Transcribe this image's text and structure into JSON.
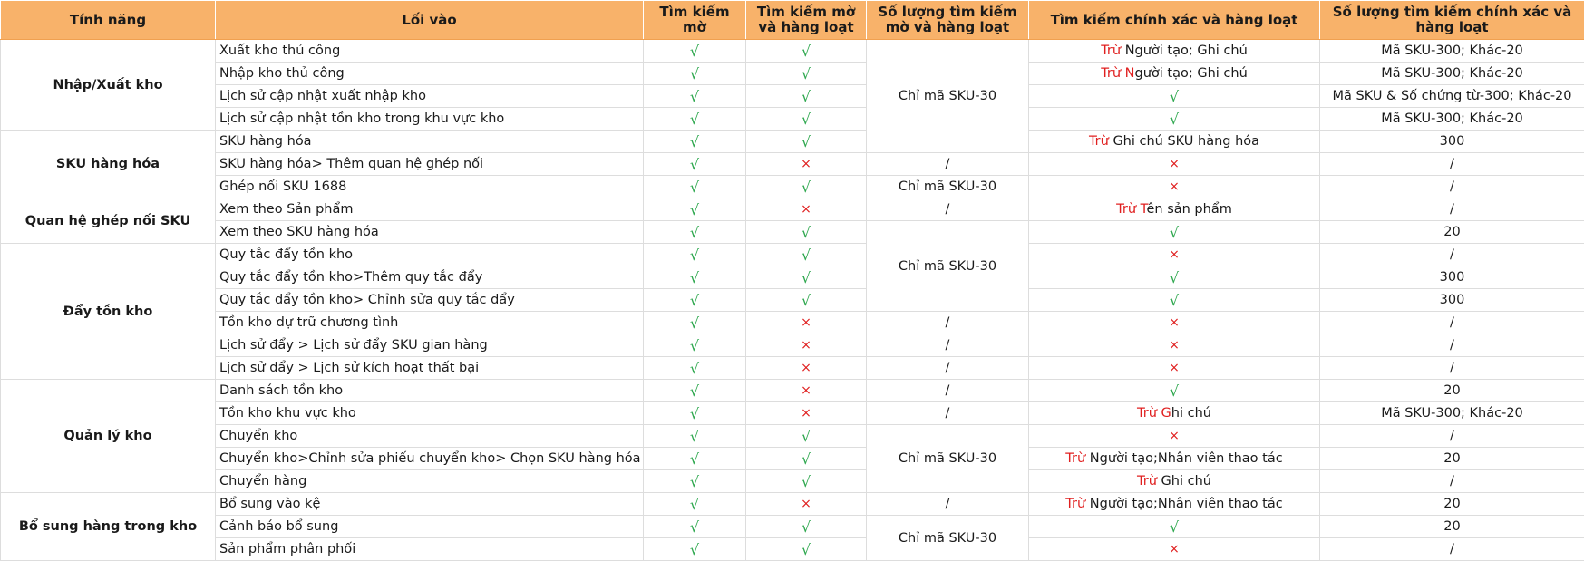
{
  "headers": {
    "feature": "Tính năng",
    "entry": "Lối vào",
    "fuzzy": "Tìm kiếm mờ",
    "fuzzy_batch": "Tìm kiếm mờ và hàng loạt",
    "fuzzy_batch_count": "Số lượng tìm kiếm mờ và hàng loạt",
    "exact_batch": "Tìm kiếm chính xác và hàng loạt",
    "exact_batch_count": "Số lượng tìm kiếm chính xác và hàng loạt"
  },
  "symbols": {
    "yes": "√",
    "no": "×"
  },
  "groups": {
    "g0": "Nhập/Xuất kho",
    "g1": "SKU hàng hóa",
    "g2": "Quan hệ ghép nối SKU",
    "g3": "Đẩy tồn kho",
    "g4": "Quản lý kho",
    "g5": "Bổ sung hàng trong kho"
  },
  "merged": {
    "m0": "Chỉ mã SKU-30",
    "m1": "Chỉ mã SKU-30",
    "m2": "Chỉ mã SKU-30",
    "m3": "Chỉ mã SKU-30",
    "m4": "Chỉ mã SKU-30"
  },
  "rows": [
    {
      "entry": "Xuất kho thủ công",
      "fuzzy": "√",
      "fuzzy_batch": "√",
      "exact_red": "Trừ ",
      "exact": "Người tạo; Ghi chú",
      "count": "Mã SKU-300; Khác-20"
    },
    {
      "entry": "Nhập kho thủ công",
      "fuzzy": "√",
      "fuzzy_batch": "√",
      "exact_red": "Trừ N",
      "exact": "gười tạo; Ghi chú",
      "count": "Mã SKU-300; Khác-20"
    },
    {
      "entry": "Lịch sử cập nhật xuất nhập kho",
      "fuzzy": "√",
      "fuzzy_batch": "√",
      "exact_red": "",
      "exact": "√",
      "count": "Mã SKU & Số chứng từ-300; Khác-20"
    },
    {
      "entry": "Lịch sử cập nhật tồn kho trong khu vực kho",
      "fuzzy": "√",
      "fuzzy_batch": "√",
      "exact_red": "",
      "exact": "√",
      "count": "Mã SKU-300; Khác-20"
    },
    {
      "entry": "SKU hàng hóa",
      "fuzzy": "√",
      "fuzzy_batch": "√",
      "exact_red": "Trừ ",
      "exact": "Ghi chú SKU hàng hóa",
      "count": "300"
    },
    {
      "entry": "SKU hàng hóa> Thêm quan hệ ghép nối",
      "fuzzy": "√",
      "fuzzy_batch": "×",
      "fuzzy_count": "/",
      "exact_red": "",
      "exact": "×",
      "count": "/"
    },
    {
      "entry": "Ghép nối SKU 1688",
      "fuzzy": "√",
      "fuzzy_batch": "√",
      "fuzzy_count": "Chỉ mã SKU-30",
      "exact_red": "",
      "exact": "×",
      "count": "/"
    },
    {
      "entry": "Xem theo Sản phẩm",
      "fuzzy": "√",
      "fuzzy_batch": "×",
      "fuzzy_count": "/",
      "exact_red": "Trừ T",
      "exact": "ên sản phẩm",
      "count": "/"
    },
    {
      "entry": "Xem theo SKU hàng hóa",
      "fuzzy": "√",
      "fuzzy_batch": "√",
      "exact_red": "",
      "exact": "√",
      "count": "20"
    },
    {
      "entry": "Quy tắc đẩy tồn kho",
      "fuzzy": "√",
      "fuzzy_batch": "√",
      "exact_red": "",
      "exact": "×",
      "count": "/"
    },
    {
      "entry": "Quy tắc đẩy tồn kho>Thêm quy tắc đẩy",
      "fuzzy": "√",
      "fuzzy_batch": "√",
      "exact_red": "",
      "exact": "√",
      "count": "300"
    },
    {
      "entry": "Quy tắc đẩy tồn kho> Chỉnh sửa quy tắc đẩy",
      "fuzzy": "√",
      "fuzzy_batch": "√",
      "exact_red": "",
      "exact": "√",
      "count": "300"
    },
    {
      "entry": "Tồn kho dự trữ chương tình",
      "fuzzy": "√",
      "fuzzy_batch": "×",
      "fuzzy_count": "/",
      "exact_red": "",
      "exact": "×",
      "count": "/"
    },
    {
      "entry": "Lịch sử đẩy > Lịch sử đẩy SKU gian hàng",
      "fuzzy": "√",
      "fuzzy_batch": "×",
      "fuzzy_count": "/",
      "exact_red": "",
      "exact": "×",
      "count": "/"
    },
    {
      "entry": "Lịch sử đẩy > Lịch sử kích hoạt thất bại",
      "fuzzy": "√",
      "fuzzy_batch": "×",
      "fuzzy_count": "/",
      "exact_red": "",
      "exact": "×",
      "count": "/"
    },
    {
      "entry": "Danh sách tồn kho",
      "fuzzy": "√",
      "fuzzy_batch": "×",
      "fuzzy_count": "/",
      "exact_red": "",
      "exact": "√",
      "count": "20"
    },
    {
      "entry": "Tồn kho khu vực kho",
      "fuzzy": "√",
      "fuzzy_batch": "×",
      "fuzzy_count": "/",
      "exact_red": "Trừ G",
      "exact": "hi chú",
      "count": "Mã SKU-300; Khác-20"
    },
    {
      "entry": "Chuyển kho",
      "fuzzy": "√",
      "fuzzy_batch": "√",
      "exact_red": "",
      "exact": "×",
      "count": "/"
    },
    {
      "entry": "Chuyển kho>Chỉnh sửa phiếu chuyển kho> Chọn SKU hàng hóa",
      "fuzzy": "√",
      "fuzzy_batch": "√",
      "exact_red": "Trừ ",
      "exact": "Người tạo;Nhân viên thao tác",
      "count": "20"
    },
    {
      "entry": "Chuyển hàng",
      "fuzzy": "√",
      "fuzzy_batch": "√",
      "exact_red": "Trừ ",
      "exact": "Ghi chú",
      "count": "/"
    },
    {
      "entry": "Bổ sung vào kệ",
      "fuzzy": "√",
      "fuzzy_batch": "×",
      "fuzzy_count": "/",
      "exact_red": "Trừ ",
      "exact": "Người tạo;Nhân viên thao tác",
      "count": "20"
    },
    {
      "entry": "Cảnh báo bổ sung",
      "fuzzy": "√",
      "fuzzy_batch": "√",
      "exact_red": "",
      "exact": "√",
      "count": "20"
    },
    {
      "entry": "Sản phẩm phân phối",
      "fuzzy": "√",
      "fuzzy_batch": "√",
      "exact_red": "",
      "exact": "×",
      "count": "/"
    }
  ]
}
